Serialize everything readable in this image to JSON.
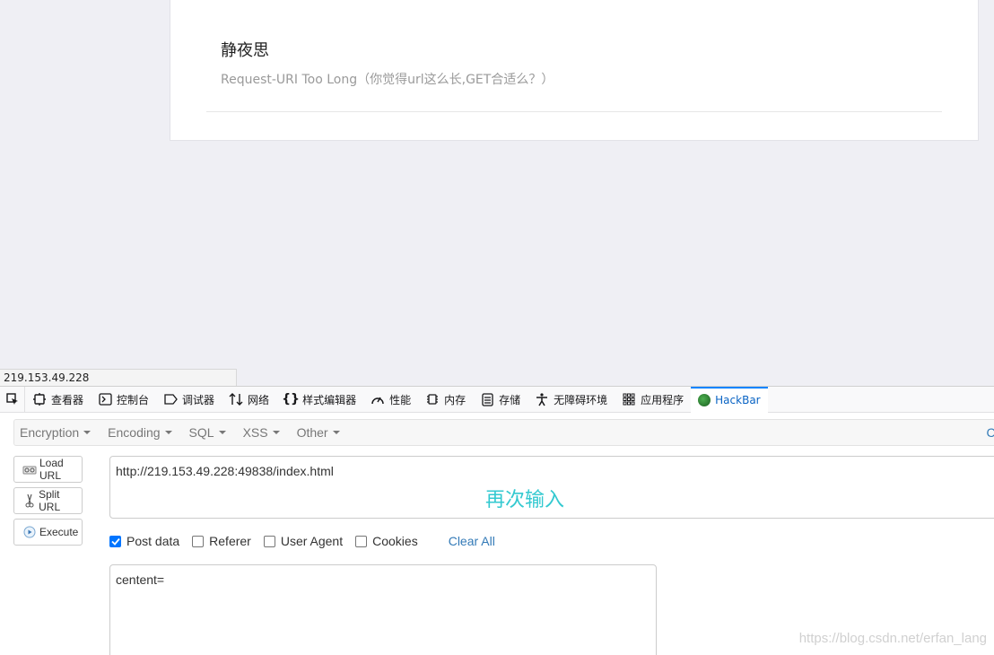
{
  "page": {
    "title": "静夜思",
    "message": "Request-URI Too Long（你觉得url这么长,GET合适么？）"
  },
  "status_url": "219.153.49.228",
  "devtools": {
    "tabs": [
      {
        "label": "查看器",
        "icon": "inspector-icon"
      },
      {
        "label": "控制台",
        "icon": "console-icon"
      },
      {
        "label": "调试器",
        "icon": "debugger-icon"
      },
      {
        "label": "网络",
        "icon": "network-icon"
      },
      {
        "label": "样式编辑器",
        "icon": "style-editor-icon"
      },
      {
        "label": "性能",
        "icon": "performance-icon"
      },
      {
        "label": "内存",
        "icon": "memory-icon"
      },
      {
        "label": "存储",
        "icon": "storage-icon"
      },
      {
        "label": "无障碍环境",
        "icon": "accessibility-icon"
      },
      {
        "label": "应用程序",
        "icon": "application-icon"
      },
      {
        "label": "HackBar",
        "icon": "hackbar-icon"
      }
    ],
    "active_tab": "HackBar"
  },
  "hackbar": {
    "menus": [
      "Encryption",
      "Encoding",
      "SQL",
      "XSS",
      "Other"
    ],
    "contribute_label": "Cor",
    "buttons": {
      "load_url": "Load URL",
      "split_url": "Split URL",
      "execute": "Execute"
    },
    "url_value": "http://219.153.49.228:49838/index.html",
    "overlay_note": "再次输入",
    "checkboxes": [
      {
        "label": "Post data",
        "checked": true
      },
      {
        "label": "Referer",
        "checked": false
      },
      {
        "label": "User Agent",
        "checked": false
      },
      {
        "label": "Cookies",
        "checked": false
      }
    ],
    "clear_all": "Clear All",
    "post_value": "centent="
  },
  "watermark": "https://blog.csdn.net/erfan_lang",
  "colors": {
    "accent": "#0a84ff",
    "link": "#337ab7",
    "note": "#33c9d0"
  }
}
